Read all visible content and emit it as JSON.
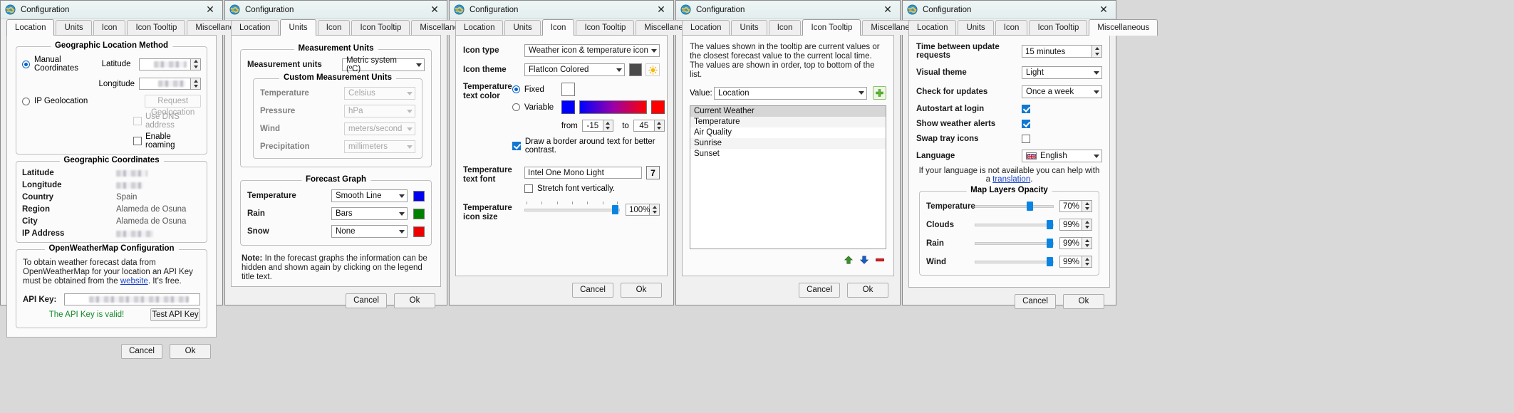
{
  "window_title": "Configuration",
  "tabs": [
    "Location",
    "Units",
    "Icon",
    "Icon Tooltip",
    "Miscellaneous"
  ],
  "buttons": {
    "cancel": "Cancel",
    "ok": "Ok"
  },
  "panel1": {
    "active_tab": "Location",
    "group_method": "Geographic Location Method",
    "manual_coordinates": "Manual Coordinates",
    "latitude_label": "Latitude",
    "longitude_label": "Longitude",
    "ip_geolocation": "IP Geolocation",
    "request_geolocation": "Request Geolocation",
    "use_dns_address": "Use DNS address",
    "enable_roaming": "Enable roaming",
    "group_coords": "Geographic Coordinates",
    "coord_rows": [
      {
        "label": "Latitude",
        "value": "",
        "blurred": true
      },
      {
        "label": "Longitude",
        "value": "",
        "blurred": true
      },
      {
        "label": "Country",
        "value": "Spain",
        "blurred": false
      },
      {
        "label": "Region",
        "value": "Alameda de Osuna",
        "blurred": false
      },
      {
        "label": "City",
        "value": "Alameda de Osuna",
        "blurred": false
      },
      {
        "label": "IP Address",
        "value": "",
        "blurred": true
      }
    ],
    "group_owm": "OpenWeatherMap Configuration",
    "owm_note_a": "To obtain weather forecast data from OpenWeatherMap for your location an API Key must be obtained from the ",
    "owm_note_link": "website",
    "owm_note_b": ". It's free.",
    "api_key_label": "API Key:",
    "api_key_valid": "The API Key is valid!",
    "test_api_key": "Test API Key"
  },
  "panel2": {
    "active_tab": "Units",
    "group_units": "Measurement Units",
    "measurement_units_label": "Measurement units",
    "measurement_units_value": "Metric system (ºC)",
    "group_custom": "Custom Measurement Units",
    "custom_rows": [
      {
        "label": "Temperature",
        "value": "Celsius"
      },
      {
        "label": "Pressure",
        "value": "hPa"
      },
      {
        "label": "Wind",
        "value": "meters/second"
      },
      {
        "label": "Precipitation",
        "value": "millimeters"
      }
    ],
    "group_forecast": "Forecast Graph",
    "forecast_rows": [
      {
        "label": "Temperature",
        "value": "Smooth Line",
        "color": "#0000ee"
      },
      {
        "label": "Rain",
        "value": "Bars",
        "color": "#008000"
      },
      {
        "label": "Snow",
        "value": "None",
        "color": "#ee0000"
      }
    ],
    "note_label": "Note:",
    "note_text": " In the forecast graphs the information can be hidden and shown again by clicking on the legend title text."
  },
  "panel3": {
    "active_tab": "Icon",
    "icon_type_label": "Icon type",
    "icon_type_value": "Weather icon & temperature icon",
    "icon_theme_label": "Icon theme",
    "icon_theme_value": "FlatIcon Colored",
    "theme_dark_swatch": "#4a4a4a",
    "temp_text_color_label": "Temperature text color",
    "fixed_label": "Fixed",
    "fixed_color": "#ffffff",
    "variable_label": "Variable",
    "variable_from_color": "#0000ff",
    "variable_to_color": "#ff0000",
    "from_label": "from",
    "from_value": "-15",
    "to_label": "to",
    "to_value": "45",
    "draw_border_label": "Draw a border around text for better contrast.",
    "temp_text_font_label": "Temperature text font",
    "temp_text_font_value": "Intel One Mono Light",
    "font_button_glyph": "7",
    "stretch_font_label": "Stretch font vertically.",
    "temp_icon_size_label": "Temperature icon size",
    "temp_icon_size_value": "100%"
  },
  "panel4": {
    "active_tab": "Icon Tooltip",
    "description": "The values shown in the tooltip are current values or the closest forecast value to the current local time. The values are shown in order, top to bottom of the list.",
    "value_label": "Value:",
    "value_selected": "Location",
    "add_button_icon": "plus-icon",
    "list_items": [
      "Current Weather",
      "Temperature",
      "Air Quality",
      "Sunrise",
      "Sunset"
    ],
    "selected_item": "Current Weather",
    "tool_icons": [
      "move-up-icon",
      "move-down-icon",
      "remove-icon"
    ]
  },
  "panel5": {
    "active_tab": "Miscellaneous",
    "rows": [
      {
        "label": "Time between update requests",
        "value": "15 minutes",
        "type": "spin"
      },
      {
        "label": "Visual theme",
        "value": "Light",
        "type": "combo"
      },
      {
        "label": "Check for updates",
        "value": "Once a week",
        "type": "combo"
      },
      {
        "label": "Autostart at login",
        "value": true,
        "type": "check"
      },
      {
        "label": "Show weather alerts",
        "value": true,
        "type": "check"
      },
      {
        "label": "Swap tray icons",
        "value": false,
        "type": "check"
      },
      {
        "label": "Language",
        "value": "English",
        "type": "combo-flag"
      }
    ],
    "translation_note_a": "If your language is not available you can help with a ",
    "translation_note_link": "translation",
    "translation_note_b": ".",
    "group_opacity": "Map Layers Opacity",
    "opacity_rows": [
      {
        "label": "Temperature",
        "value": "70%",
        "pct": 70
      },
      {
        "label": "Clouds",
        "value": "99%",
        "pct": 99
      },
      {
        "label": "Rain",
        "value": "99%",
        "pct": 99
      },
      {
        "label": "Wind",
        "value": "99%",
        "pct": 99
      }
    ]
  }
}
